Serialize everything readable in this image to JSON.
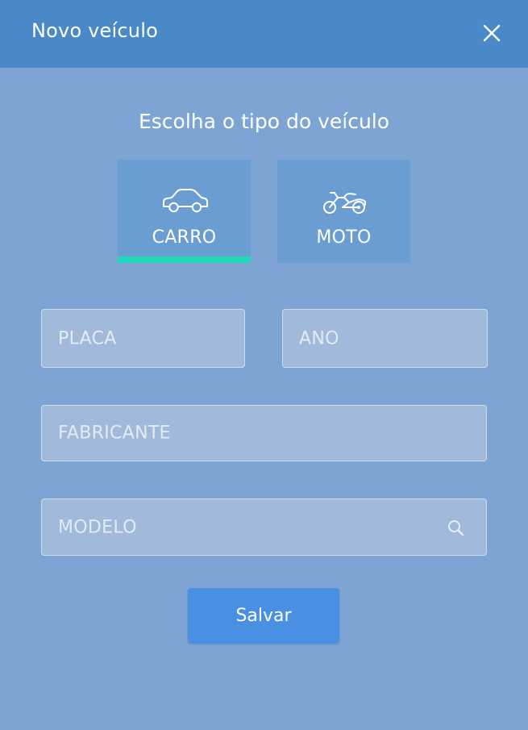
{
  "dialog": {
    "title": "Novo veículo",
    "close_icon": "close-icon"
  },
  "vehicle_type": {
    "prompt": "Escolha o tipo do veículo",
    "options": [
      {
        "label": "CARRO",
        "icon": "car-icon",
        "selected": true
      },
      {
        "label": "MOTO",
        "icon": "motorcycle-icon",
        "selected": false
      }
    ]
  },
  "form": {
    "placa": {
      "placeholder": "PLACA",
      "value": ""
    },
    "ano": {
      "placeholder": "ANO",
      "value": ""
    },
    "fabricante": {
      "placeholder": "FABRICANTE",
      "value": ""
    },
    "modelo": {
      "placeholder": "MODELO",
      "value": "",
      "icon": "search-icon"
    }
  },
  "actions": {
    "save_label": "Salvar"
  },
  "colors": {
    "header": "#4a89c8",
    "background": "#7ea4d4",
    "tile": "#6a9ed3",
    "selected_indicator": "#23d8b8",
    "primary_button": "#4a90e2"
  }
}
